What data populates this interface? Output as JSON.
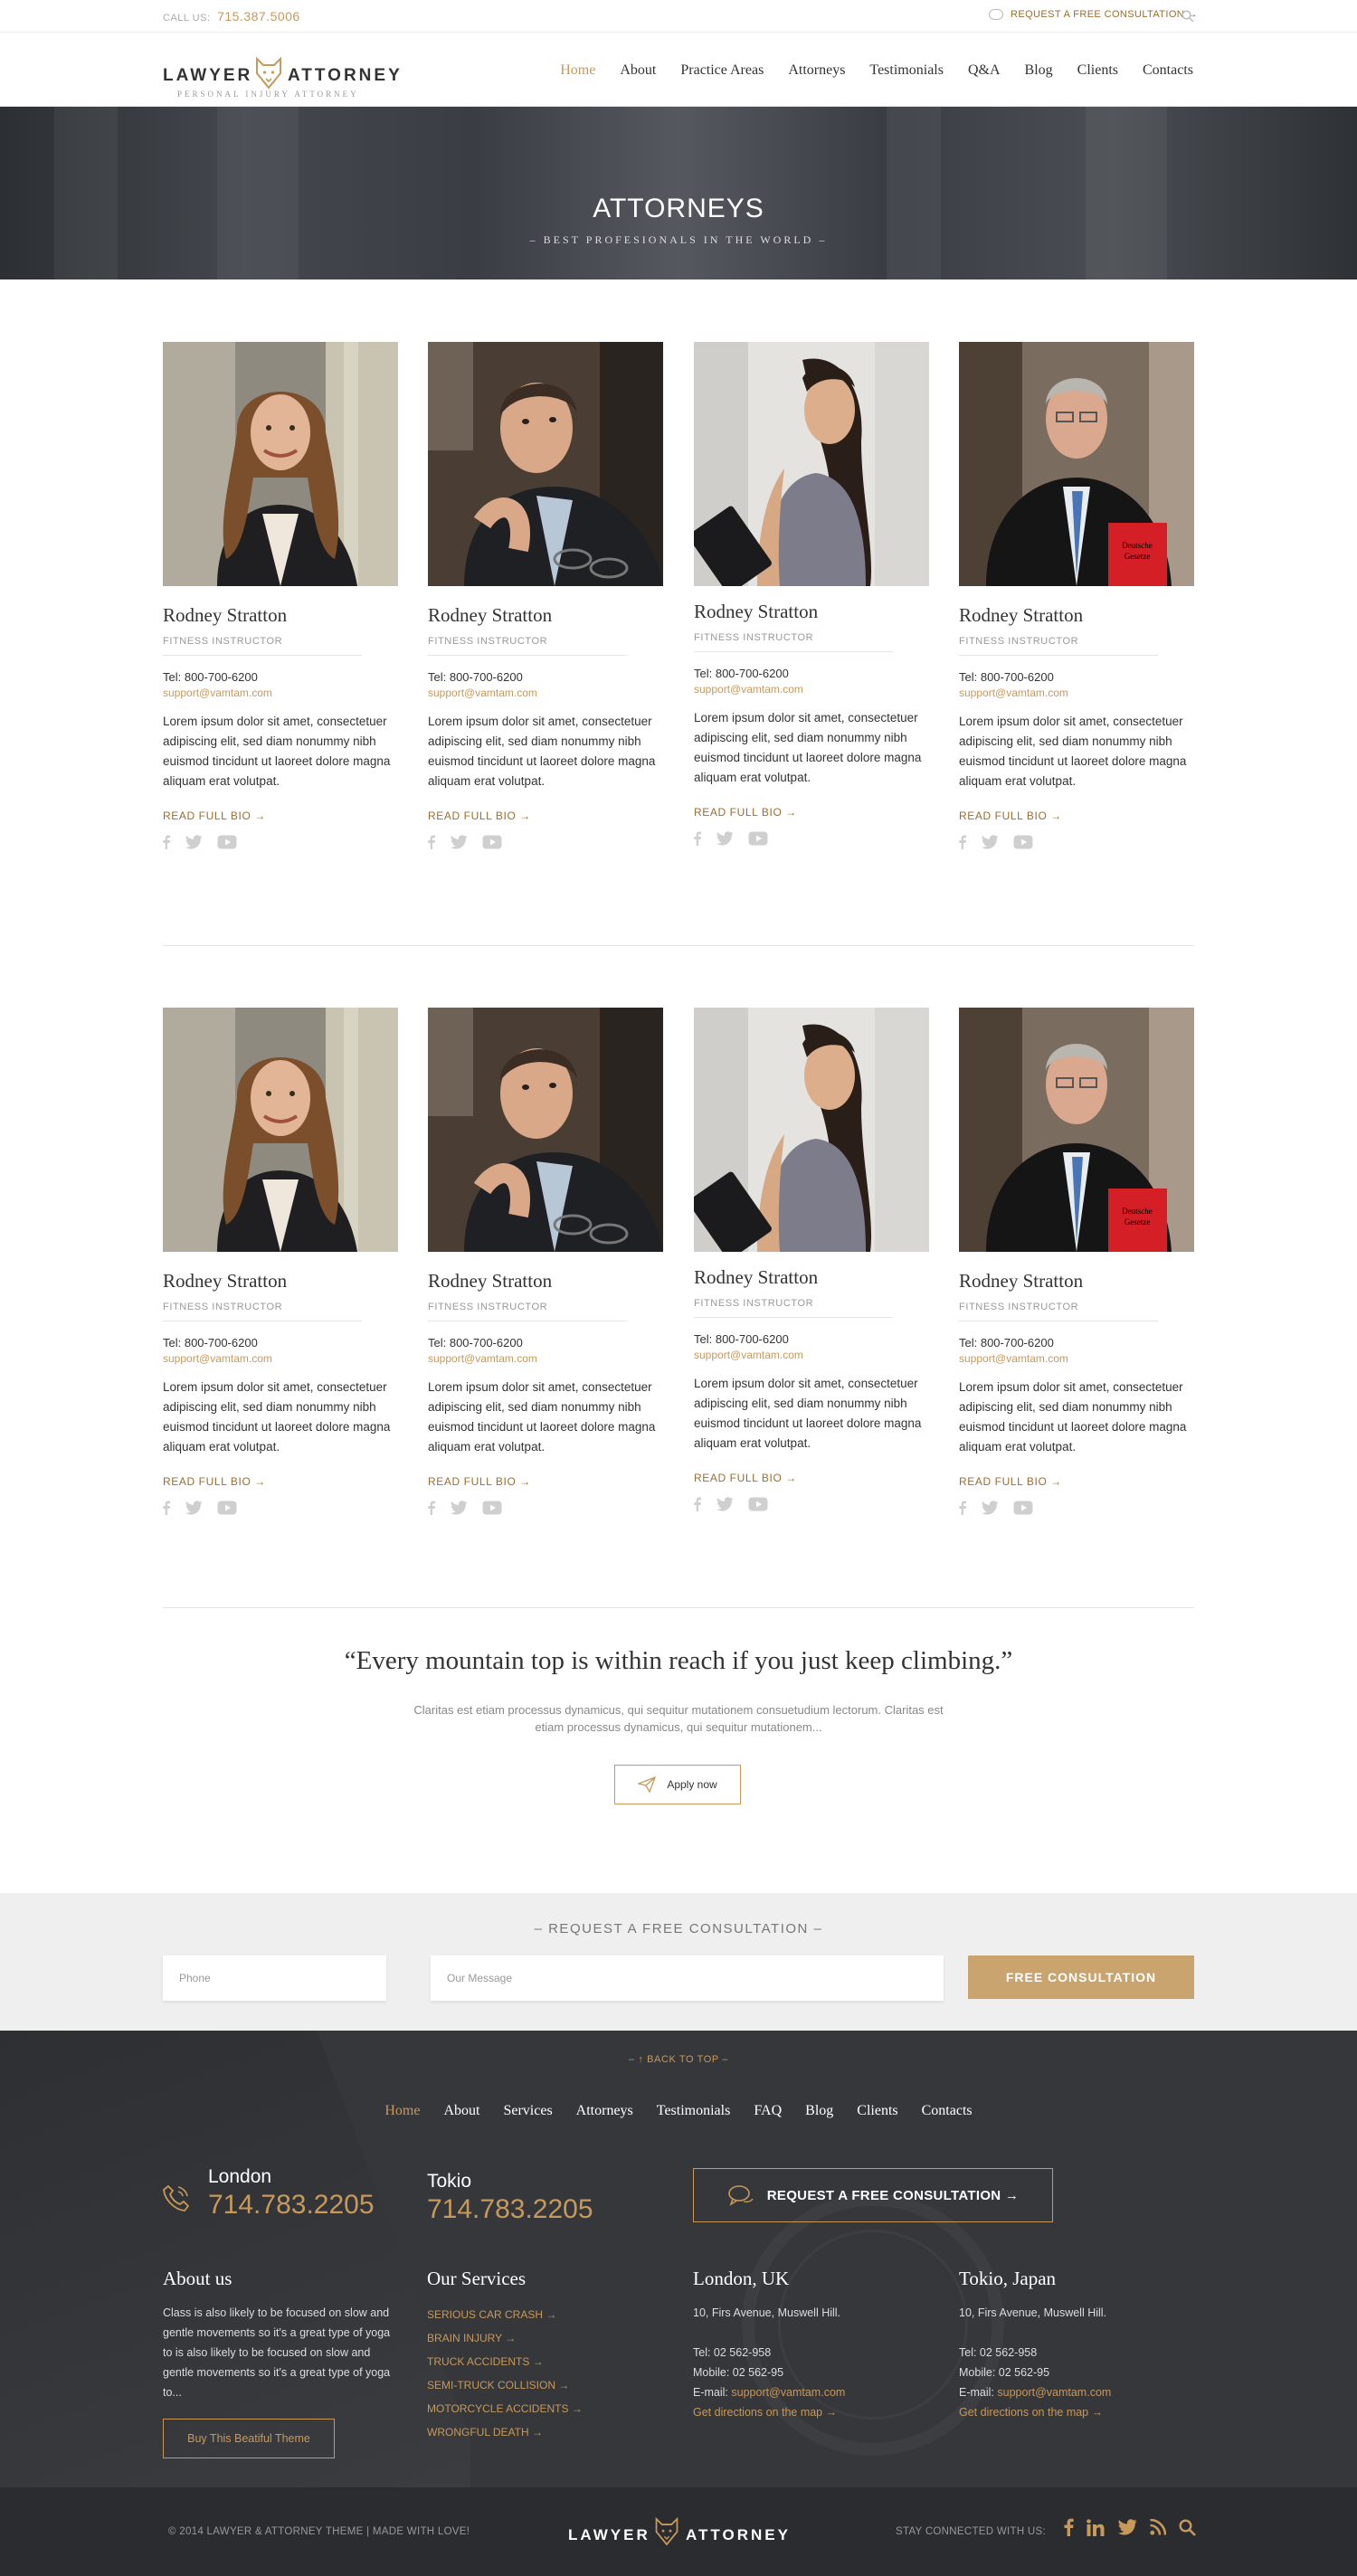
{
  "topbar": {
    "call_label": "CALL US:",
    "phone": "715.387.5006",
    "consult_link": "REQUEST A FREE CONSULTATION →"
  },
  "header": {
    "logo_word1": "LAWYER",
    "logo_word2": "ATTORNEY",
    "logo_sub": "PERSONAL INJURY ATTORNEY",
    "nav": [
      "Home",
      "About",
      "Practice Areas",
      "Attorneys",
      "Testimonials",
      "Q&A",
      "Blog",
      "Clients",
      "Contacts"
    ],
    "active_nav": "Home"
  },
  "hero": {
    "title": "ATTORNEYS",
    "tagline": "– BEST PROFESIONALS IN THE WORLD –"
  },
  "attorneys": [
    {
      "name": "Rodney Stratton",
      "role": "FITNESS INSTRUCTOR",
      "tel": "Tel: 800-700-6200",
      "email": "support@vamtam.com",
      "bio": "Lorem ipsum dolor sit amet, consectetuer adipiscing elit, sed diam nonummy nibh euismod tincidunt ut laoreet dolore magna aliquam erat volutpat.",
      "more": "READ FULL BIO →",
      "photo": "woman-curly-hair"
    },
    {
      "name": "Rodney Stratton",
      "role": "FITNESS INSTRUCTOR",
      "tel": "Tel: 800-700-6200",
      "email": "support@vamtam.com",
      "bio": "Lorem ipsum dolor sit amet, consectetuer adipiscing elit, sed diam nonummy nibh euismod tincidunt ut laoreet dolore magna aliquam erat volutpat.",
      "more": "READ FULL BIO →",
      "photo": "man-with-glasses"
    },
    {
      "name": "Rodney Stratton",
      "role": "FITNESS INSTRUCTOR",
      "tel": "Tel: 800-700-6200",
      "email": "support@vamtam.com",
      "bio": "Lorem ipsum dolor sit amet, consectetuer adipiscing elit, sed diam nonummy nibh euismod tincidunt ut laoreet dolore magna aliquam erat volutpat.",
      "more": "READ FULL BIO →",
      "photo": "woman-with-tablet"
    },
    {
      "name": "Rodney Stratton",
      "role": "FITNESS INSTRUCTOR",
      "tel": "Tel: 800-700-6200",
      "email": "support@vamtam.com",
      "bio": "Lorem ipsum dolor sit amet, consectetuer adipiscing elit, sed diam nonummy nibh euismod tincidunt ut laoreet dolore magna aliquam erat volutpat.",
      "more": "READ FULL BIO →",
      "photo": "judge-with-red-book"
    }
  ],
  "quote": {
    "text": "“Every mountain top is within reach if you just keep climbing.”",
    "sub": "Claritas est etiam processus dynamicus, qui sequitur mutationem consuetudium lectorum. Claritas est etiam processus dynamicus, qui sequitur mutationem...",
    "button": "Apply now"
  },
  "consultation": {
    "title": "– REQUEST A FREE CONSULTATION –",
    "phone_placeholder": "Phone",
    "message_placeholder": "Our Message",
    "button": "FREE CONSULTATION"
  },
  "footer": {
    "back_to_top": "– ↑ BACK TO TOP –",
    "nav": [
      "Home",
      "About",
      "Services",
      "Attorneys",
      "Testimonials",
      "FAQ",
      "Blog",
      "Clients",
      "Contacts"
    ],
    "cities": [
      {
        "name": "London",
        "phone": "714.783.2205"
      },
      {
        "name": "Tokio",
        "phone": "714.783.2205"
      }
    ],
    "consult_button": "REQUEST A FREE CONSULTATION →",
    "about": {
      "title": "About us",
      "text": "Class is also likely to be focused on slow and gentle movements so it's a great type of yoga to is also likely to be focused on slow and gentle movements so it's a great type of yoga to...",
      "button": "Buy This Beatiful Theme"
    },
    "services": {
      "title": "Our Services",
      "items": [
        "SERIOUS CAR CRASH →",
        "BRAIN INJURY →",
        "TRUCK ACCIDENTS →",
        "SEMI-TRUCK COLLISION →",
        "MOTORCYCLE ACCIDENTS →",
        "WRONGFUL DEATH →"
      ]
    },
    "offices": [
      {
        "title": "London, UK",
        "address": "10, Firs Avenue, Muswell Hill.",
        "tel": "Tel: 02 562-958",
        "mobile": "Mobile: 02 562-95",
        "email_label": "E-mail:",
        "email": "support@vamtam.com",
        "directions": "Get directions on the map →"
      },
      {
        "title": "Tokio, Japan",
        "address": "10, Firs Avenue, Muswell Hill.",
        "tel": "Tel: 02 562-958",
        "mobile": "Mobile: 02 562-95",
        "email_label": "E-mail:",
        "email": "support@vamtam.com",
        "directions": "Get directions on the map →"
      }
    ]
  },
  "bottom": {
    "copyright": "© 2014 LAWYER & ATTORNEY THEME | MADE WITH LOVE!",
    "logo_word1": "LAWYER",
    "logo_word2": "ATTORNEY",
    "stay": "STAY CONNECTED WITH US:",
    "social_icons": [
      "facebook-icon",
      "linkedin-icon",
      "twitter-icon",
      "rss-icon",
      "search-icon"
    ]
  },
  "colors": {
    "accent": "#c7995a",
    "dark": "#35373b",
    "band": "#efefef"
  }
}
